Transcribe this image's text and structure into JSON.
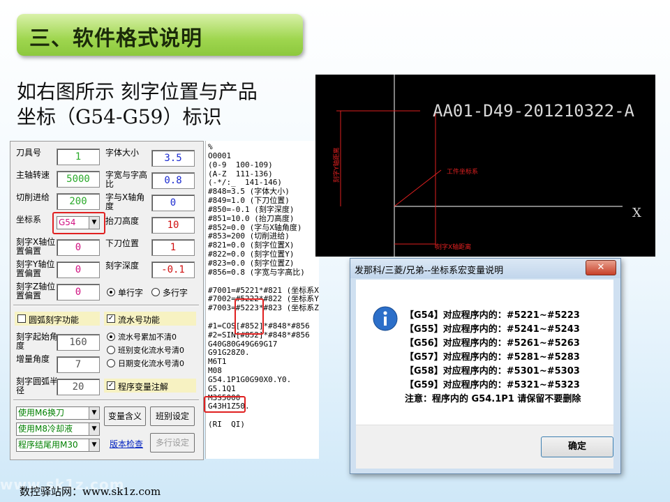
{
  "title": "三、软件格式说明",
  "intro": [
    "如右图所示 刻字位置与产品",
    "坐标（G54-G59）标识"
  ],
  "params": {
    "tool_no_label": "刀具号",
    "tool_no": "1",
    "spindle_label": "主轴转速",
    "spindle": "5000",
    "feed_label": "切削进给",
    "feed": "200",
    "coord_label": "坐标系",
    "coord": "G54",
    "x_offset_label": "刻字X轴位置偏置",
    "x_offset": "0",
    "y_offset_label": "刻字Y轴位置偏置",
    "y_offset": "0",
    "z_offset_label": "刻字Z轴位置偏置",
    "z_offset": "0",
    "font_size_label": "字体大小",
    "font_size": "3.5",
    "width_ratio_label": "字宽与字高比",
    "width_ratio": "0.8",
    "angle_label": "字与X轴角度",
    "angle": "0",
    "lift_label": "抬刀高度",
    "lift": "10",
    "down_label": "下刀位置",
    "down": "1",
    "depth_label": "刻字深度",
    "depth": "-0.1",
    "single_line": "单行字",
    "multi_line": "多行字",
    "arc_engrave": "圆弧刻字功能",
    "start_angle_label": "刻字起始角度",
    "start_angle": "160",
    "incr_angle_label": "增量角度",
    "incr_angle": "7",
    "arc_radius_label": "刻字圆弧半径",
    "arc_radius": "20",
    "serial": "流水号功能",
    "serial_opt1": "流水号累加不清0",
    "serial_opt2": "班别变化流水号清0",
    "serial_opt3": "日期变化流水号清0",
    "program_var": "程序变量注解",
    "dd1": "使用M6换刀",
    "dd2": "使用M8冷却液",
    "dd3": "程序结尾用M30",
    "btn_var": "变量含义",
    "btn_shift": "班别设定",
    "btn_check": "版本检查",
    "btn_multi": "多行设定"
  },
  "code_lines": [
    "%",
    "O0001",
    "(0-9  100-109)",
    "(A-Z  111-136)",
    "(-*/:_  141-146)",
    "#848=3.5 (字体大小)",
    "#849=1.0 (下刀位置)",
    "#850=-0.1 (刻字深度)",
    "#851=10.0 (抬刀高度)",
    "#852=0.0 (字与X轴角度)",
    "#853=200 (切削进给)",
    "#821=0.0 (刻字位置X)",
    "#822=0.0 (刻字位置Y)",
    "#823=0.0 (刻字位置Z)",
    "#856=0.8 (字宽与字高比)",
    "",
    "#7001=#5221*#821 (坐标系X)",
    "#7002=#5222*#822 (坐标系Y)",
    "#7003=#5223*#823 (坐标系Z)",
    "",
    "#1=COS[#852]*#848*#856",
    "#2=SIN[#852]*#848*#856",
    "G40G80G49G69G17",
    "G91G28Z0.",
    "M6T1",
    "M08",
    "G54.1P1G0G90X0.Y0.",
    "G5.1Q1",
    "M3S5000",
    "G43H1Z50.",
    "",
    "(RI  QI)"
  ],
  "cad": {
    "text": "AA01-D49-201210322-A",
    "axis_x": "X",
    "workpiece": "工件坐标系",
    "y_dist": "刻字Y轴距离",
    "x_dist": "刻字X轴距离"
  },
  "dialog": {
    "title": "发那科/三菱/兄弟--坐标系宏变量说明",
    "lines": [
      "【G54】对应程序内的：#5221~#5223",
      "【G55】对应程序内的：#5241~#5243",
      "【G56】对应程序内的：#5261~#5263",
      "【G57】对应程序内的：#5281~#5283",
      "【G58】对应程序内的：#5301~#5303",
      "【G59】对应程序内的：#5321~#5323",
      "注意：程序内的 G54.1P1 请保留不要删除"
    ],
    "ok": "确定"
  },
  "footer": "数控驿站网：www.sk1z.com",
  "watermark": "www.sk1z.com"
}
